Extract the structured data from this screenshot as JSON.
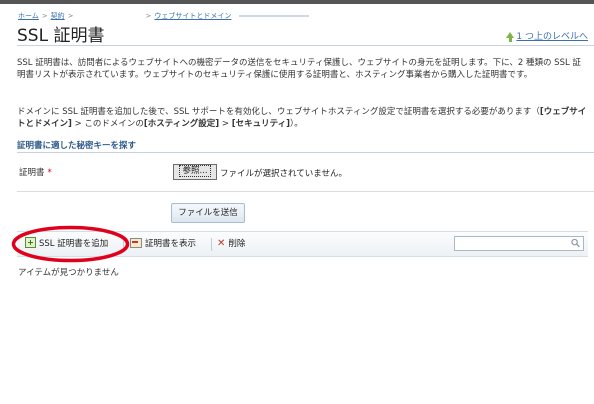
{
  "breadcrumb": {
    "home": "ホーム",
    "contract": "契約",
    "websites": "ウェブサイトとドメイン"
  },
  "page": {
    "title": "SSL 証明書",
    "up_level": "1 つ上のレベルへ"
  },
  "intro": {
    "p1": "SSL 証明書は、訪問者によるウェブサイトへの機密データの送信をセキュリティ保護し、ウェブサイトの身元を証明します。下に、2 種類の SSL 証明書リストが表示されています。ウェブサイトのセキュリティ保護に使用する証明書と、ホスティング事業者から購入した証明書です。",
    "p2_a": "ドメインに SSL 証明書を追加した後で、SSL サポートを有効化し、ウェブサイトホスティング設定で証明書を選択する必要があります（",
    "p2_b": "[ウェブサイトとドメイン]",
    "p2_c": " > このドメインの",
    "p2_d": "[ホスティング設定]",
    "p2_e": " > ",
    "p2_f": "[セキュリティ]",
    "p2_g": "）。"
  },
  "form": {
    "section_title": "証明書に適した秘密キーを探す",
    "cert_label": "証明書",
    "required_mark": "*",
    "browse_label": "参照...",
    "no_file_text": "ファイルが選択されていません。",
    "submit_label": "ファイルを送信"
  },
  "toolbar": {
    "add_label": "SSL 証明書を追加",
    "view_label": "証明書を表示",
    "delete_label": "削除",
    "search_value": ""
  },
  "list": {
    "empty_text": "アイテムが見つかりません"
  },
  "colors": {
    "accent": "#3a6fb0",
    "annotation": "#e0001b"
  },
  "icons": {
    "up": "up-arrow-icon",
    "add": "add-certificate-icon",
    "view": "view-certificate-icon",
    "delete": "delete-icon",
    "search": "search-icon"
  }
}
